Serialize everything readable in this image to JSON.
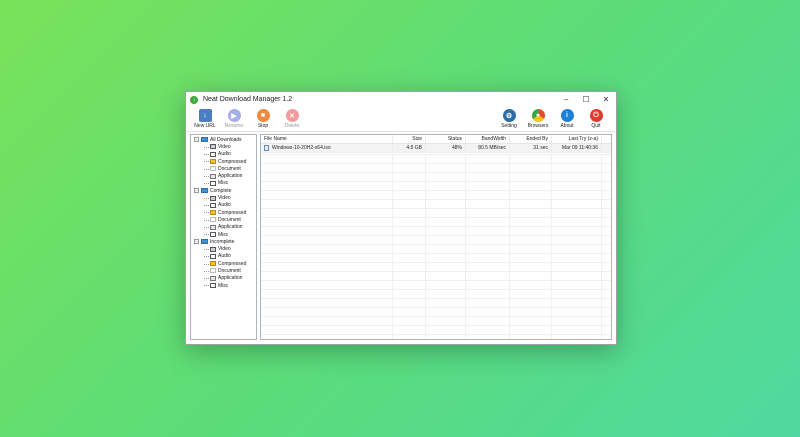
{
  "window": {
    "title": "Neat Download Manager 1.2",
    "controls": {
      "minimize": "–",
      "maximize": "☐",
      "close": "✕"
    }
  },
  "toolbar": {
    "left": [
      {
        "label": "New URL",
        "icon": "new-url-icon",
        "enabled": true,
        "color": "#4a7fc4"
      },
      {
        "label": "Resume",
        "icon": "resume-icon",
        "enabled": false,
        "color": "#5a6fd8"
      },
      {
        "label": "Stop",
        "icon": "stop-icon",
        "enabled": true,
        "color": "#f08a3c"
      },
      {
        "label": "Delete",
        "icon": "delete-icon",
        "enabled": false,
        "color": "#f04a4a"
      }
    ],
    "right": [
      {
        "label": "Setting",
        "icon": "gear-icon",
        "color": "#2f6fa8"
      },
      {
        "label": "Browsers",
        "icon": "browser-icon",
        "color": "#e34d2e"
      },
      {
        "label": "About",
        "icon": "info-icon",
        "color": "#1e7fd6"
      },
      {
        "label": "Quit",
        "icon": "power-icon",
        "color": "#e33a2e"
      }
    ]
  },
  "tree": [
    {
      "label": "All Downloads",
      "level": 0,
      "icon": "folder",
      "expander": "−"
    },
    {
      "label": "Video",
      "level": 1,
      "icon": "video"
    },
    {
      "label": "Audio",
      "level": 1,
      "icon": "audio"
    },
    {
      "label": "Compressed",
      "level": 1,
      "icon": "compressed"
    },
    {
      "label": "Document",
      "level": 1,
      "icon": "document"
    },
    {
      "label": "Application",
      "level": 1,
      "icon": "application"
    },
    {
      "label": "Misc",
      "level": 1,
      "icon": "misc"
    },
    {
      "label": "Complete",
      "level": 0,
      "icon": "folder",
      "expander": "−"
    },
    {
      "label": "Video",
      "level": 1,
      "icon": "video"
    },
    {
      "label": "Audio",
      "level": 1,
      "icon": "audio"
    },
    {
      "label": "Compressed",
      "level": 1,
      "icon": "compressed"
    },
    {
      "label": "Document",
      "level": 1,
      "icon": "document"
    },
    {
      "label": "Application",
      "level": 1,
      "icon": "application"
    },
    {
      "label": "Misc",
      "level": 1,
      "icon": "misc"
    },
    {
      "label": "Incomplete",
      "level": 0,
      "icon": "folder",
      "expander": "−"
    },
    {
      "label": "Video",
      "level": 1,
      "icon": "video"
    },
    {
      "label": "Audio",
      "level": 1,
      "icon": "audio"
    },
    {
      "label": "Compressed",
      "level": 1,
      "icon": "compressed"
    },
    {
      "label": "Document",
      "level": 1,
      "icon": "document"
    },
    {
      "label": "Application",
      "level": 1,
      "icon": "application"
    },
    {
      "label": "Misc",
      "level": 1,
      "icon": "misc"
    }
  ],
  "list": {
    "columns": [
      "File Name",
      "Size",
      "Status",
      "BandWidth",
      "Ended By",
      "Last Try (z-a)"
    ],
    "rows": [
      [
        "Windows-10-20H2-x64.iso",
        "4.5 GB",
        "48%",
        "80.5 MB/sec",
        "31 sec",
        "Mar 09  11:40:36"
      ]
    ]
  }
}
